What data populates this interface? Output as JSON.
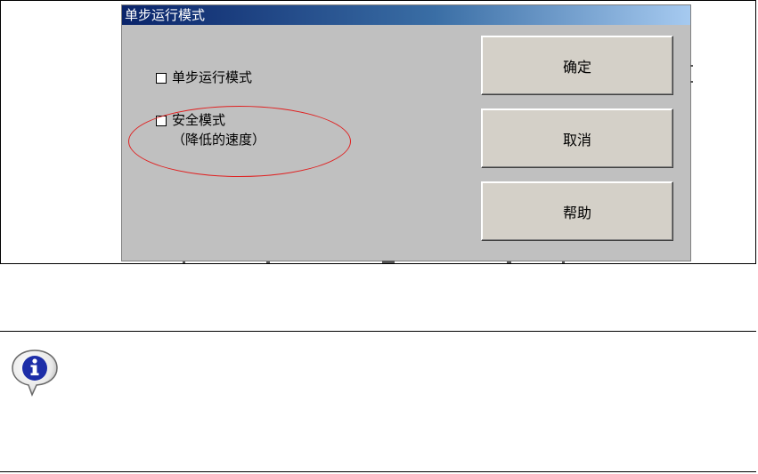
{
  "dialog": {
    "title": "单步运行模式",
    "options": [
      {
        "label_line1": "单步运行模式",
        "label_line2": "",
        "checked": false
      },
      {
        "label_line1": "安全模式",
        "label_line2": "（降低的速度）",
        "checked": false
      }
    ],
    "buttons": {
      "ok": "确定",
      "cancel": "取消",
      "help": "帮助"
    }
  },
  "note": {
    "icon": "info-speech-bubble-icon"
  },
  "colors": {
    "dialog_bg": "#c0c0c0",
    "title_bar": "#0a246a",
    "highlight": "#e02020",
    "button_face": "#d4d0c8"
  }
}
